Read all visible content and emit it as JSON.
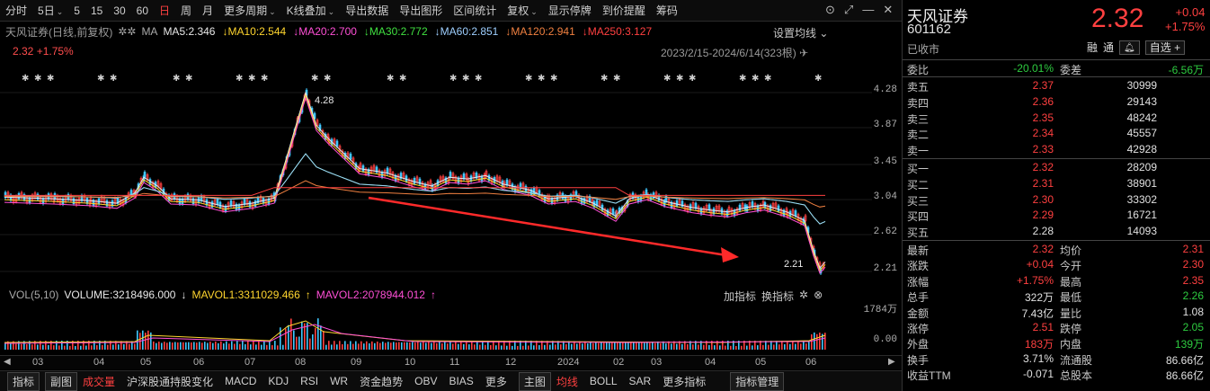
{
  "toolbar": {
    "items": [
      "分时",
      "5日",
      "5",
      "15",
      "30",
      "60",
      "日",
      "周",
      "月",
      "更多周期",
      "K线叠加",
      "导出数据",
      "导出图形",
      "区间统计",
      "复权",
      "显示停牌",
      "到价提醒",
      "筹码"
    ],
    "active_index": 6,
    "caret_indices": [
      1,
      9,
      10,
      14
    ]
  },
  "legend": {
    "title": "天风证券(日线,前复权)",
    "icons": "✲✲",
    "ma_label": "MA",
    "ma5": "MA5:2.346",
    "ma10": "MA10:2.544",
    "ma20": "MA20:2.700",
    "ma30": "MA30:2.772",
    "ma60": "MA60:2.851",
    "ma120": "MA120:2.941",
    "ma250": "MA250:3.127",
    "arrow": "↓",
    "settings": "设置均线"
  },
  "price_line": "2.32 +1.75%",
  "range_text": "2023/2/15-2024/6/14(323根)",
  "y_axis": [
    "4.28",
    "3.87",
    "3.45",
    "3.04",
    "2.62",
    "2.21"
  ],
  "annotations": {
    "high": "4.28",
    "low": "2.21"
  },
  "volume": {
    "label": "VOL(5,10)",
    "volume": "VOLUME:3218496.000",
    "arrow1": "↓",
    "mavol1": "MAVOL1:3311029.466",
    "arrow2": "↑",
    "mavol2": "MAVOL2:2078944.012",
    "arrow3": "↑",
    "add": "加指标",
    "switch": "换指标",
    "y_top": "1784万",
    "y_bottom": "0.00"
  },
  "x_axis": [
    "03",
    "04",
    "05",
    "06",
    "07",
    "08",
    "09",
    "10",
    "11",
    "12",
    "2024",
    "02",
    "03",
    "04",
    "05",
    "06"
  ],
  "bottombar": {
    "boxes": [
      "指标",
      "副图"
    ],
    "items": [
      "成交量",
      "沪深股通持股变化",
      "MACD",
      "KDJ",
      "RSI",
      "WR",
      "资金趋势",
      "OBV",
      "BIAS",
      "更多"
    ],
    "box2": "主图",
    "items2": [
      "均线",
      "BOLL",
      "SAR",
      "更多指标"
    ],
    "manage": "指标管理"
  },
  "quote": {
    "name": "天风证券",
    "code": "601162",
    "status": "已收市",
    "price": "2.32",
    "change": "+0.04",
    "change_pct": "+1.75%",
    "tools": [
      "融",
      "通",
      "自选 +"
    ],
    "webi": {
      "label": "委比",
      "value": "-20.01%",
      "label2": "委差",
      "value2": "-6.56万"
    },
    "sells": [
      {
        "label": "卖五",
        "price": "2.37",
        "vol": "30999"
      },
      {
        "label": "卖四",
        "price": "2.36",
        "vol": "29143"
      },
      {
        "label": "卖三",
        "price": "2.35",
        "vol": "48242"
      },
      {
        "label": "卖二",
        "price": "2.34",
        "vol": "45557"
      },
      {
        "label": "卖一",
        "price": "2.33",
        "vol": "42928"
      }
    ],
    "buys": [
      {
        "label": "买一",
        "price": "2.32",
        "vol": "28209"
      },
      {
        "label": "买二",
        "price": "2.31",
        "vol": "38901"
      },
      {
        "label": "买三",
        "price": "2.30",
        "vol": "33302"
      },
      {
        "label": "买四",
        "price": "2.29",
        "vol": "16721"
      },
      {
        "label": "买五",
        "price": "2.28",
        "vol": "14093"
      }
    ],
    "stats": [
      {
        "l": "最新",
        "v": "2.32",
        "vc": "red",
        "l2": "均价",
        "v2": "2.31",
        "vc2": "red"
      },
      {
        "l": "涨跌",
        "v": "+0.04",
        "vc": "red",
        "l2": "今开",
        "v2": "2.30",
        "vc2": "red"
      },
      {
        "l": "涨幅",
        "v": "+1.75%",
        "vc": "red",
        "l2": "最高",
        "v2": "2.35",
        "vc2": "red"
      },
      {
        "l": "总手",
        "v": "322万",
        "vc": "white",
        "l2": "最低",
        "v2": "2.26",
        "vc2": "green"
      },
      {
        "l": "金额",
        "v": "7.43亿",
        "vc": "white",
        "l2": "量比",
        "v2": "1.08",
        "vc2": "white"
      },
      {
        "l": "涨停",
        "v": "2.51",
        "vc": "red",
        "l2": "跌停",
        "v2": "2.05",
        "vc2": "green"
      },
      {
        "l": "外盘",
        "v": "183万",
        "vc": "red",
        "l2": "内盘",
        "v2": "139万",
        "vc2": "green"
      },
      {
        "l": "换手",
        "v": "3.71%",
        "vc": "white",
        "l2": "流通股",
        "v2": "86.66亿",
        "vc2": "white"
      },
      {
        "l": "收益TTM",
        "v": "-0.071",
        "vc": "white",
        "l2": "总股本",
        "v2": "86.66亿",
        "vc2": "white"
      }
    ]
  }
}
